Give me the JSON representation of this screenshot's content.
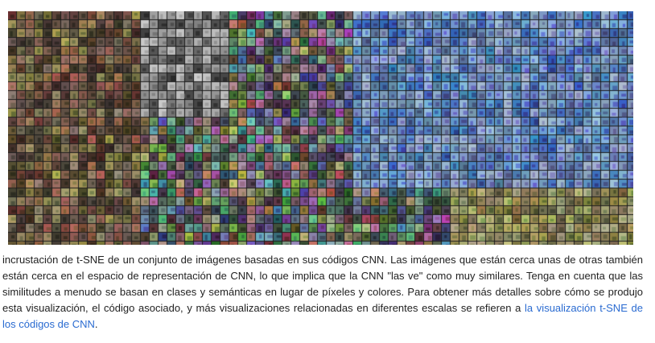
{
  "figure": {
    "image_alt": "",
    "palette": {
      "background": "#1c1c1c",
      "link": "#2a6bd1",
      "text": "#222222"
    }
  },
  "caption": {
    "text_before_link": "incrustación de t-SNE de un conjunto de imágenes basadas en sus códigos CNN. Las imágenes que están cerca unas de otras también están cerca en el espacio de representación de CNN, lo que implica que la CNN \"las ve\" como muy similares. Tenga en cuenta que las similitudes a menudo se basan en clases y semánticas en lugar de píxeles y colores. Para obtener más detalles sobre cómo se produjo esta visualización, el código asociado, y más visualizaciones relacionadas en diferentes escalas se refieren a ",
    "link_text": "la visualización t-SNE de los códigos de CNN",
    "text_after_link": "."
  }
}
